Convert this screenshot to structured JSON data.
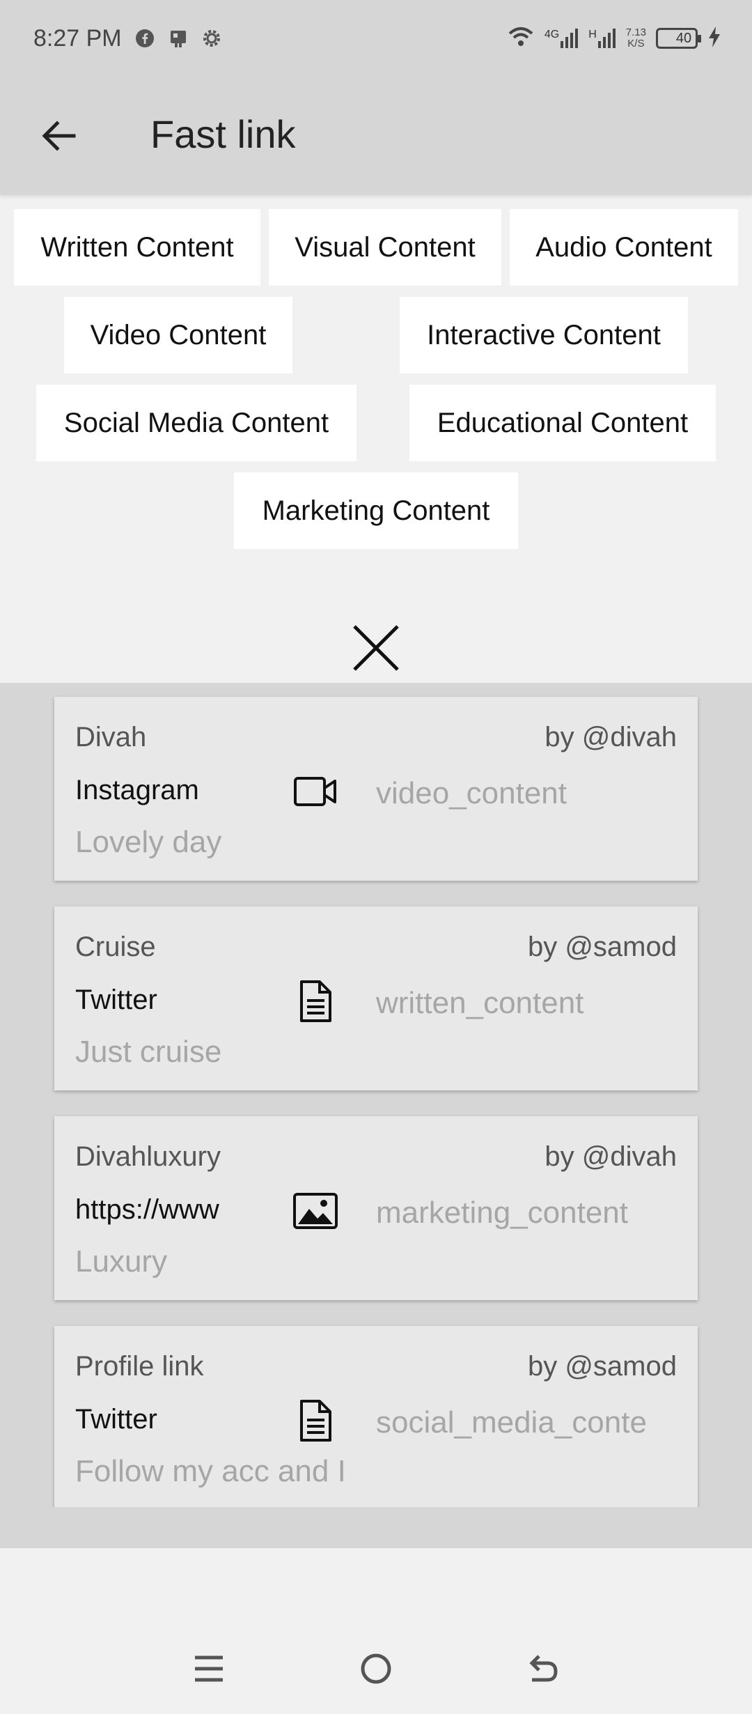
{
  "status_bar": {
    "time": "8:27 PM",
    "app_icons": [
      "facebook-icon",
      "media-icon",
      "settings-gear-icon"
    ],
    "network_4g": "4G",
    "network_h": "H",
    "speed_value": "7.13",
    "speed_unit": "K/S",
    "battery_level": "40",
    "battery_fraction": 0.4
  },
  "app_bar": {
    "title": "Fast link"
  },
  "filter_chips": [
    {
      "label": "Written Content"
    },
    {
      "label": "Visual Content"
    },
    {
      "label": "Audio Content"
    },
    {
      "label": "Video Content"
    },
    {
      "label": "Interactive Content"
    },
    {
      "label": "Social Media Content"
    },
    {
      "label": "Educational Content"
    },
    {
      "label": "Marketing Content"
    }
  ],
  "cards": [
    {
      "title": "Divah",
      "author": "by @divah",
      "platform": "Instagram",
      "icon": "video-camera-icon",
      "type": "video_content",
      "description": "Lovely day"
    },
    {
      "title": "Cruise",
      "author": "by @samod",
      "platform": "Twitter",
      "icon": "document-icon",
      "type": "written_content",
      "description": "Just cruise"
    },
    {
      "title": "Divahluxury",
      "author": "by @divah",
      "platform": "https://www",
      "icon": "image-icon",
      "type": "marketing_content",
      "description": "Luxury"
    },
    {
      "title": "Profile link",
      "author": "by @samod",
      "platform": "Twitter",
      "icon": "document-icon",
      "type": "social_media_conte",
      "description": "Follow my acc and I"
    }
  ],
  "colors": {
    "app_bar_bg": "#d6d6d6",
    "page_bg": "#f1f1f1",
    "chip_bg": "#ffffff",
    "card_bg": "#e8e8e8",
    "muted_text": "#a6a6a6"
  }
}
